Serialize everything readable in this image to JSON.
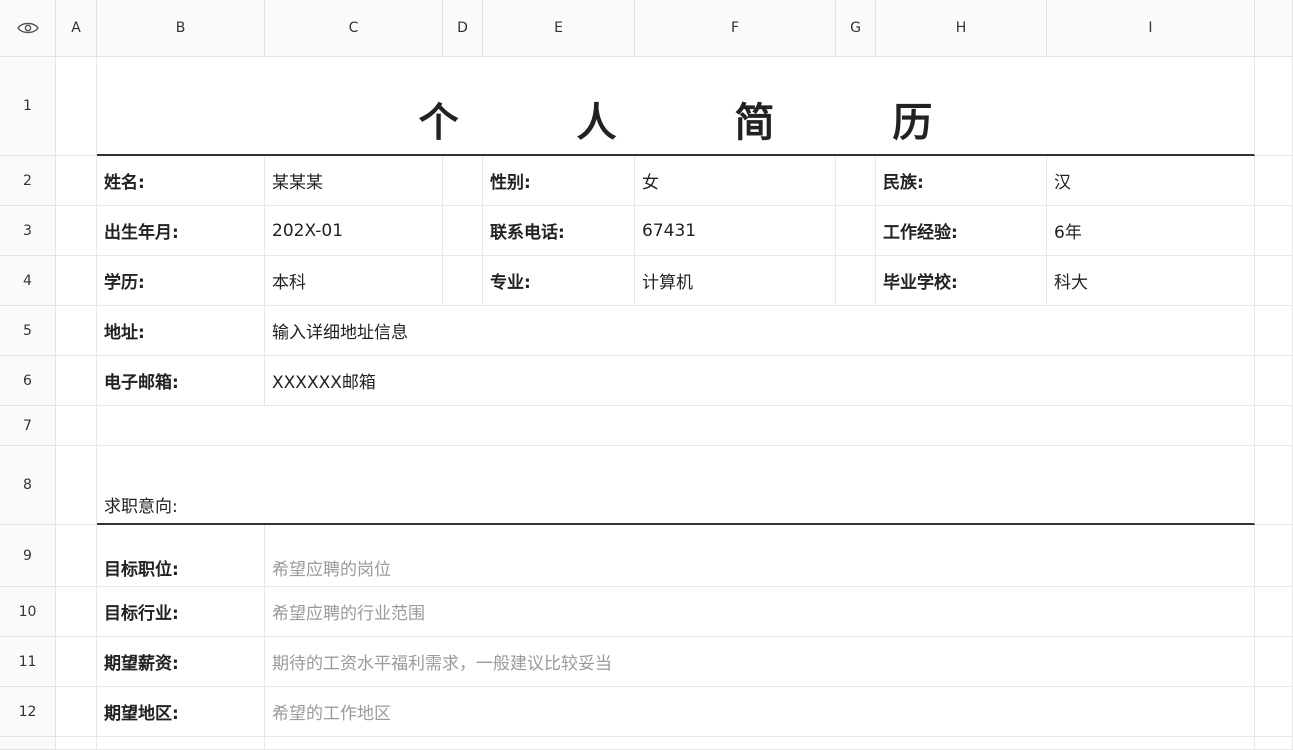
{
  "columns": [
    "A",
    "B",
    "C",
    "D",
    "E",
    "F",
    "G",
    "H",
    "I"
  ],
  "rows": [
    "1",
    "2",
    "3",
    "4",
    "5",
    "6",
    "7",
    "8",
    "9",
    "10",
    "11",
    "12"
  ],
  "title": "个 人 简 历",
  "info": {
    "name_label": "姓名:",
    "name_value": "某某某",
    "gender_label": "性别:",
    "gender_value": "女",
    "ethnicity_label": "民族:",
    "ethnicity_value": "汉",
    "birth_label": "出生年月:",
    "birth_value": "202X-01",
    "phone_label": "联系电话:",
    "phone_value": "67431",
    "experience_label": "工作经验:",
    "experience_value": "6年",
    "education_label": "学历:",
    "education_value": "本科",
    "major_label": "专业:",
    "major_value": "计算机",
    "school_label": "毕业学校:",
    "school_value": "科大",
    "address_label": "地址:",
    "address_value": "输入详细地址信息",
    "email_label": "电子邮箱:",
    "email_value": "XXXXXX邮箱"
  },
  "intent": {
    "heading": "求职意向:",
    "position_label": "目标职位:",
    "position_value": "希望应聘的岗位",
    "industry_label": "目标行业:",
    "industry_value": "希望应聘的行业范围",
    "salary_label": "期望薪资:",
    "salary_value": "期待的工资水平福利需求，一般建议比较妥当",
    "region_label": "期望地区:",
    "region_value": "希望的工作地区"
  },
  "icons": {
    "corner": "eye-icon"
  }
}
